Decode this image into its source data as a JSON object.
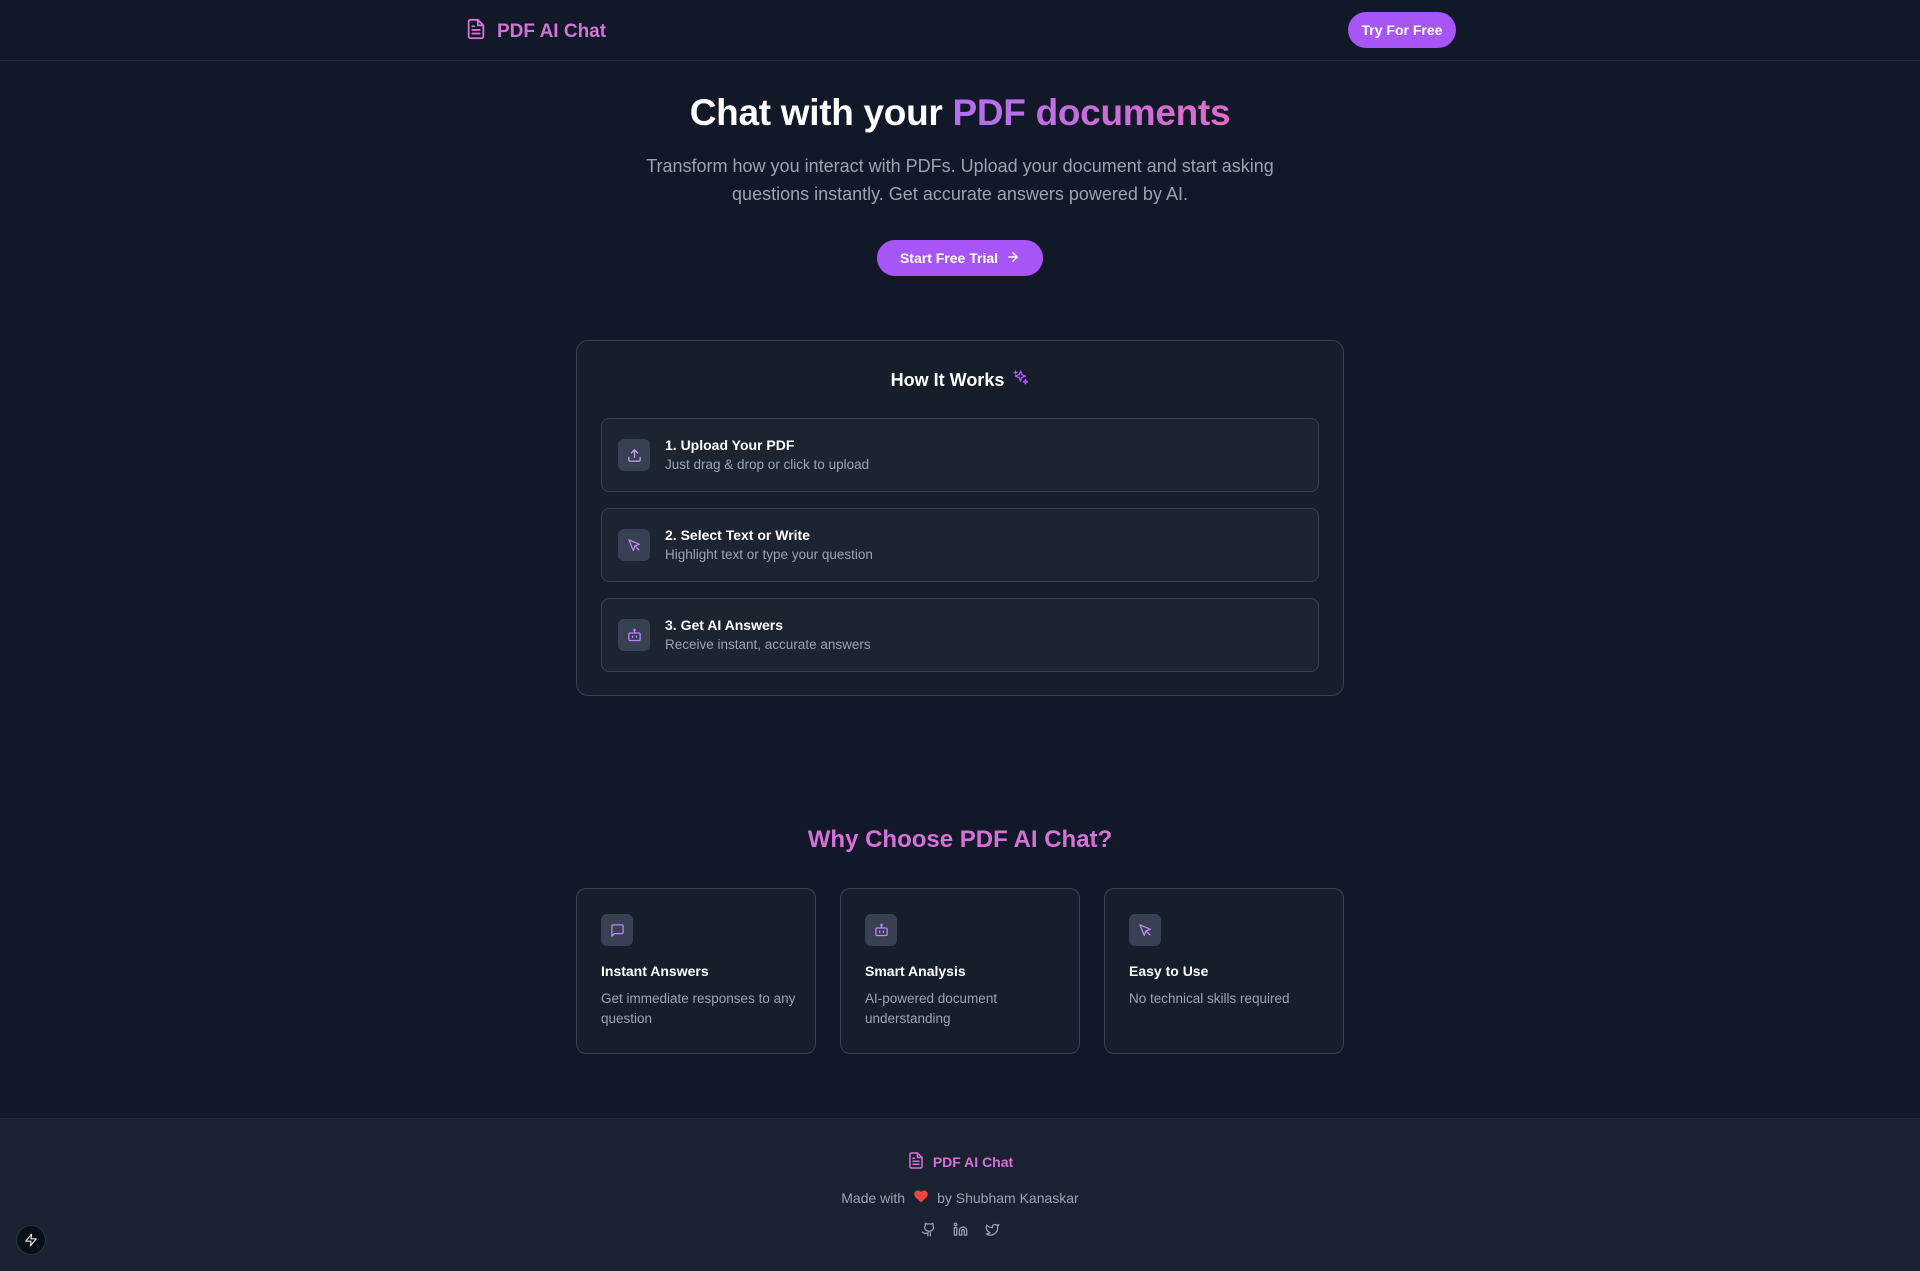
{
  "nav": {
    "brand": "PDF AI Chat",
    "try_button": "Try For Free"
  },
  "hero": {
    "title_plain": "Chat with your ",
    "title_highlight": "PDF documents",
    "subtitle": "Transform how you interact with PDFs. Upload your document and start asking questions instantly. Get accurate answers powered by AI.",
    "cta": "Start Free Trial"
  },
  "how": {
    "title": "How It Works",
    "steps": [
      {
        "title": "1. Upload Your PDF",
        "desc": "Just drag & drop or click to upload",
        "icon": "upload-icon"
      },
      {
        "title": "2. Select Text or Write",
        "desc": "Highlight text or type your question",
        "icon": "cursor-icon"
      },
      {
        "title": "3. Get AI Answers",
        "desc": "Receive instant, accurate answers",
        "icon": "bot-icon"
      }
    ]
  },
  "why": {
    "title": "Why Choose PDF AI Chat?",
    "features": [
      {
        "title": "Instant Answers",
        "desc": "Get immediate responses to any question",
        "icon": "chat-icon"
      },
      {
        "title": "Smart Analysis",
        "desc": "AI-powered document understanding",
        "icon": "bot-icon"
      },
      {
        "title": "Easy to Use",
        "desc": "No technical skills required",
        "icon": "cursor-icon"
      }
    ]
  },
  "footer": {
    "brand": "PDF AI Chat",
    "made_prefix": "Made with",
    "made_suffix": "by Shubham Kanaskar",
    "socials": [
      "github-icon",
      "linkedin-icon",
      "twitter-icon"
    ]
  },
  "colors": {
    "background": "#111827",
    "accent": "#a855f7",
    "brand_pink": "#d572d8",
    "heart": "#ef4444"
  }
}
